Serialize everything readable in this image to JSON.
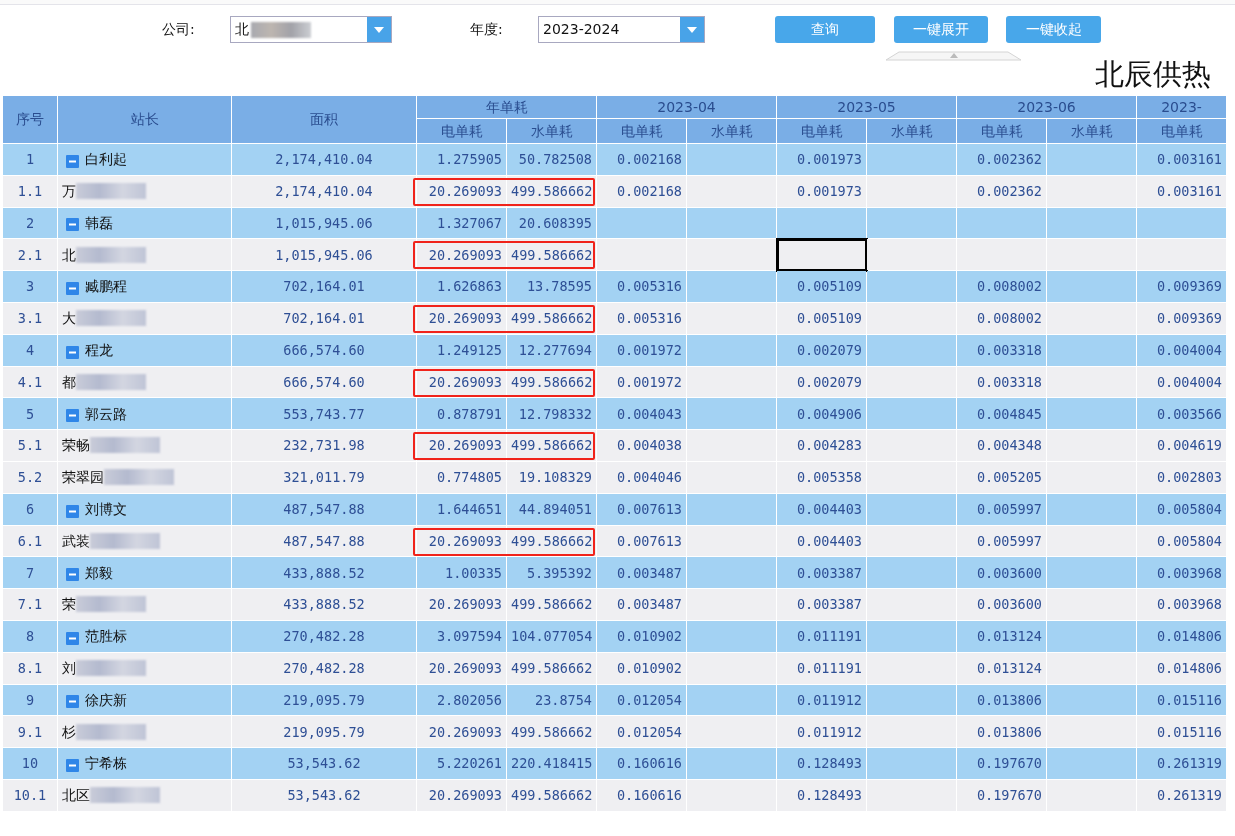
{
  "filters": [
    {
      "label": "公司:",
      "value": "北",
      "blurred": true
    },
    {
      "label": "年度:",
      "value": "2023-2024",
      "blurred": false
    }
  ],
  "buttons": [
    "查询",
    "一键展开",
    "一键收起"
  ],
  "title": "北辰供热",
  "table": {
    "fixed_columns": [
      "序号",
      "站长",
      "面积"
    ],
    "column_groups": [
      {
        "label": "年单耗",
        "subs": [
          "电单耗",
          "水单耗"
        ]
      },
      {
        "label": "2023-04",
        "subs": [
          "电单耗",
          "水单耗"
        ]
      },
      {
        "label": "2023-05",
        "subs": [
          "电单耗",
          "水单耗"
        ]
      },
      {
        "label": "2023-06",
        "subs": [
          "电单耗",
          "水单耗"
        ]
      },
      {
        "label": "2023-",
        "subs": [
          "电单耗"
        ]
      }
    ],
    "rows": [
      {
        "kind": "group",
        "no": "1",
        "name": "白利起",
        "expanded": true,
        "area": "2,174,410.04",
        "cells": [
          "1.275905",
          "50.782508",
          "0.002168",
          null,
          "0.001973",
          null,
          "0.002362",
          null,
          "0.003161"
        ],
        "highlighted": false
      },
      {
        "kind": "station",
        "no": "1.1",
        "name": "万",
        "blurred": true,
        "area": "2,174,410.04",
        "cells": [
          "20.269093",
          "499.586662",
          "0.002168",
          null,
          "0.001973",
          null,
          "0.002362",
          null,
          "0.003161"
        ],
        "highlighted": true
      },
      {
        "kind": "group",
        "no": "2",
        "name": "韩磊",
        "expanded": true,
        "area": "1,015,945.06",
        "cells": [
          "1.327067",
          "20.608395",
          null,
          null,
          null,
          null,
          null,
          null,
          null
        ],
        "highlighted": false
      },
      {
        "kind": "station",
        "no": "2.1",
        "name": "北",
        "blurred": true,
        "area": "1,015,945.06",
        "cells": [
          "20.269093",
          "499.586662",
          null,
          null,
          null,
          null,
          null,
          null,
          null
        ],
        "highlighted": true,
        "selected_cells": [
          false,
          false,
          false,
          false,
          true,
          false,
          false,
          false,
          false
        ]
      },
      {
        "kind": "group",
        "no": "3",
        "name": "臧鹏程",
        "expanded": true,
        "area": "702,164.01",
        "cells": [
          "1.626863",
          "13.78595",
          "0.005316",
          null,
          "0.005109",
          null,
          "0.008002",
          null,
          "0.009369"
        ],
        "highlighted": false
      },
      {
        "kind": "station",
        "no": "3.1",
        "name": "大",
        "blurred": true,
        "area": "702,164.01",
        "cells": [
          "20.269093",
          "499.586662",
          "0.005316",
          null,
          "0.005109",
          null,
          "0.008002",
          null,
          "0.009369"
        ],
        "highlighted": true
      },
      {
        "kind": "group",
        "no": "4",
        "name": "程龙",
        "expanded": true,
        "area": "666,574.60",
        "cells": [
          "1.249125",
          "12.277694",
          "0.001972",
          null,
          "0.002079",
          null,
          "0.003318",
          null,
          "0.004004"
        ],
        "highlighted": false
      },
      {
        "kind": "station",
        "no": "4.1",
        "name": "都",
        "blurred": true,
        "area": "666,574.60",
        "cells": [
          "20.269093",
          "499.586662",
          "0.001972",
          null,
          "0.002079",
          null,
          "0.003318",
          null,
          "0.004004"
        ],
        "highlighted": true
      },
      {
        "kind": "group",
        "no": "5",
        "name": "郭云路",
        "expanded": true,
        "area": "553,743.77",
        "cells": [
          "0.878791",
          "12.798332",
          "0.004043",
          null,
          "0.004906",
          null,
          "0.004845",
          null,
          "0.003566"
        ],
        "highlighted": false
      },
      {
        "kind": "station",
        "no": "5.1",
        "name": "荣畅",
        "blurred": true,
        "area": "232,731.98",
        "cells": [
          "20.269093",
          "499.586662",
          "0.004038",
          null,
          "0.004283",
          null,
          "0.004348",
          null,
          "0.004619"
        ],
        "highlighted": true
      },
      {
        "kind": "station",
        "no": "5.2",
        "name": "荣翠园",
        "blurred": true,
        "area": "321,011.79",
        "cells": [
          "0.774805",
          "19.108329",
          "0.004046",
          null,
          "0.005358",
          null,
          "0.005205",
          null,
          "0.002803"
        ],
        "highlighted": false
      },
      {
        "kind": "group",
        "no": "6",
        "name": "刘博文",
        "expanded": true,
        "area": "487,547.88",
        "cells": [
          "1.644651",
          "44.894051",
          "0.007613",
          null,
          "0.004403",
          null,
          "0.005997",
          null,
          "0.005804"
        ],
        "highlighted": false
      },
      {
        "kind": "station",
        "no": "6.1",
        "name": "武装",
        "blurred": true,
        "area": "487,547.88",
        "cells": [
          "20.269093",
          "499.586662",
          "0.007613",
          null,
          "0.004403",
          null,
          "0.005997",
          null,
          "0.005804"
        ],
        "highlighted": true
      },
      {
        "kind": "group",
        "no": "7",
        "name": "郑毅",
        "expanded": true,
        "area": "433,888.52",
        "cells": [
          "1.00335",
          "5.395392",
          "0.003487",
          null,
          "0.003387",
          null,
          "0.003600",
          null,
          "0.003968"
        ],
        "highlighted": false
      },
      {
        "kind": "station",
        "no": "7.1",
        "name": "荣",
        "blurred": true,
        "area": "433,888.52",
        "cells": [
          "20.269093",
          "499.586662",
          "0.003487",
          null,
          "0.003387",
          null,
          "0.003600",
          null,
          "0.003968"
        ],
        "highlighted": false
      },
      {
        "kind": "group",
        "no": "8",
        "name": "范胜标",
        "expanded": true,
        "area": "270,482.28",
        "cells": [
          "3.097594",
          "104.077054",
          "0.010902",
          null,
          "0.011191",
          null,
          "0.013124",
          null,
          "0.014806"
        ],
        "highlighted": false
      },
      {
        "kind": "station",
        "no": "8.1",
        "name": "刘",
        "blurred": true,
        "area": "270,482.28",
        "cells": [
          "20.269093",
          "499.586662",
          "0.010902",
          null,
          "0.011191",
          null,
          "0.013124",
          null,
          "0.014806"
        ],
        "highlighted": false
      },
      {
        "kind": "group",
        "no": "9",
        "name": "徐庆新",
        "expanded": true,
        "area": "219,095.79",
        "cells": [
          "2.802056",
          "23.8754",
          "0.012054",
          null,
          "0.011912",
          null,
          "0.013806",
          null,
          "0.015116"
        ],
        "highlighted": false
      },
      {
        "kind": "station",
        "no": "9.1",
        "name": "杉",
        "blurred": true,
        "area": "219,095.79",
        "cells": [
          "20.269093",
          "499.586662",
          "0.012054",
          null,
          "0.011912",
          null,
          "0.013806",
          null,
          "0.015116"
        ],
        "highlighted": false
      },
      {
        "kind": "group",
        "no": "10",
        "name": "宁希栋",
        "expanded": true,
        "area": "53,543.62",
        "cells": [
          "5.220261",
          "220.418415",
          "0.160616",
          null,
          "0.128493",
          null,
          "0.197670",
          null,
          "0.261319"
        ],
        "highlighted": false
      },
      {
        "kind": "station",
        "no": "10.1",
        "name": "北区",
        "blurred": true,
        "area": "53,543.62",
        "cells": [
          "20.269093",
          "499.586662",
          "0.160616",
          null,
          "0.128493",
          null,
          "0.197670",
          null,
          "0.261319"
        ],
        "highlighted": false
      }
    ]
  }
}
